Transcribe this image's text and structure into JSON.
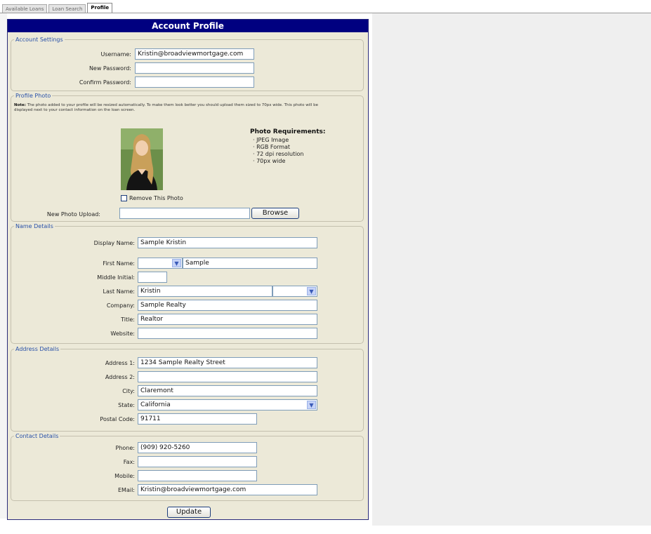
{
  "tabs": [
    "Available Loans",
    "Loan Search",
    "Profile"
  ],
  "panel_title": "Account Profile",
  "account_settings": {
    "legend": "Account Settings",
    "username_label": "Username:",
    "username_value": "Kristin@broadviewmortgage.com",
    "new_password_label": "New Password:",
    "confirm_password_label": "Confirm Password:"
  },
  "profile_photo": {
    "legend": "Profile Photo",
    "note_label": "Note:",
    "note_text": "The photo added to your profile will be resized automatically. To make them look better you should upload them sized to 70px wide. This photo will be displayed next to your contact information on the loan screen.",
    "requirements_title": "Photo Requirements:",
    "requirements": [
      "· JPEG Image",
      "· RGB Format",
      "· 72 dpi resolution",
      "· 70px wide"
    ],
    "remove_label": "Remove This Photo",
    "upload_label": "New Photo Upload:",
    "browse_label": "Browse"
  },
  "name_details": {
    "legend": "Name Details",
    "display_name_label": "Display Name:",
    "display_name_value": "Sample Kristin",
    "first_name_label": "First Name:",
    "first_name_value": "Sample",
    "middle_initial_label": "Middle Initial:",
    "last_name_label": "Last Name:",
    "last_name_value": "Kristin",
    "company_label": "Company:",
    "company_value": "Sample Realty",
    "title_label": "Title:",
    "title_value": "Realtor",
    "website_label": "Website:"
  },
  "address_details": {
    "legend": "Address Details",
    "address1_label": "Address 1:",
    "address1_value": "1234 Sample Realty Street",
    "address2_label": "Address 2:",
    "city_label": "City:",
    "city_value": "Claremont",
    "state_label": "State:",
    "state_value": "California",
    "postal_label": "Postal Code:",
    "postal_value": "91711"
  },
  "contact_details": {
    "legend": "Contact Details",
    "phone_label": "Phone:",
    "phone_value": "(909) 920-5260",
    "fax_label": "Fax:",
    "mobile_label": "Mobile:",
    "email_label": "EMail:",
    "email_value": "Kristin@broadviewmortgage.com"
  },
  "update_label": "Update",
  "colors": {
    "title_bar": "#000080",
    "panel_bg": "#ece9d8",
    "legend": "#2850a8"
  }
}
